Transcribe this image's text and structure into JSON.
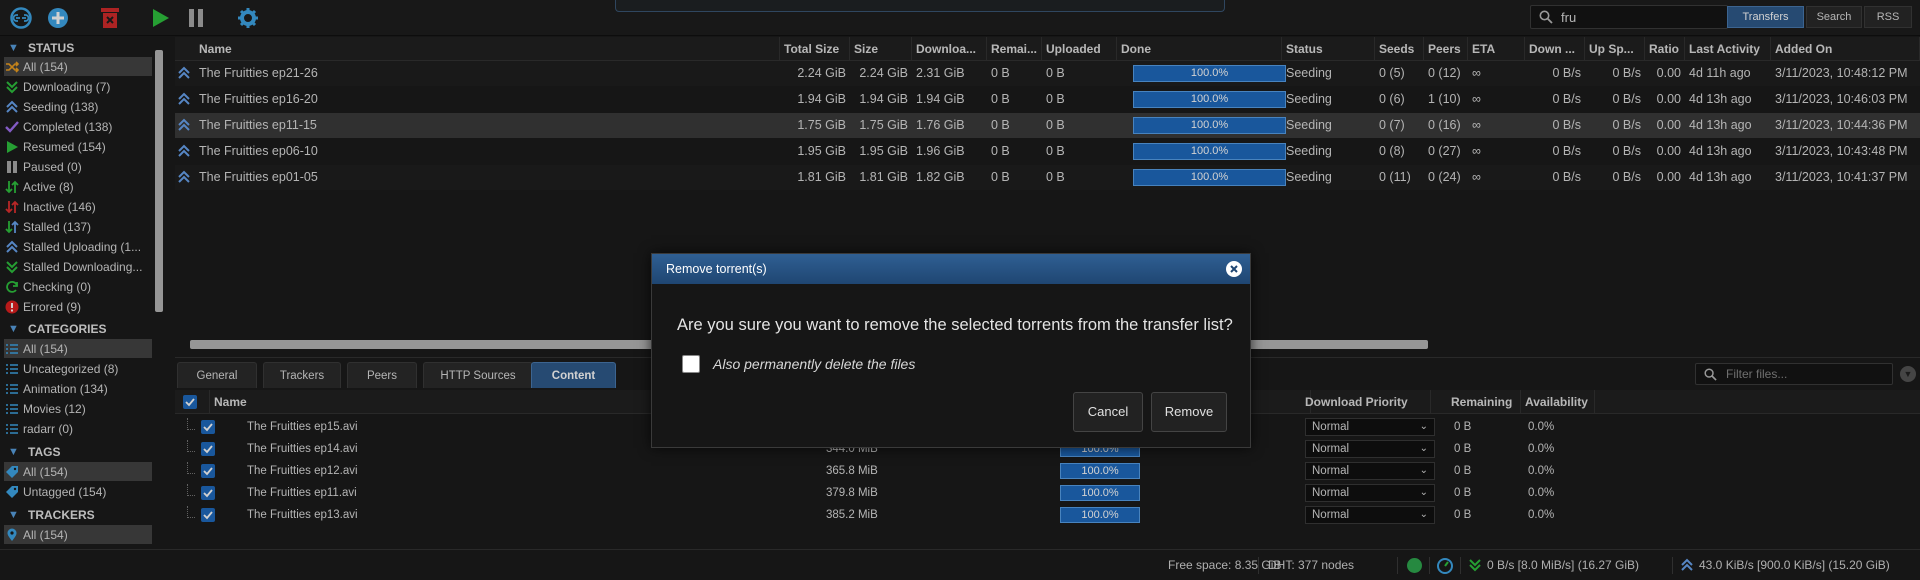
{
  "toolbar": {
    "icons": [
      "link-icon",
      "add-icon",
      "delete-icon",
      "play-icon",
      "pause-icon",
      "gear-icon"
    ],
    "search_value": "fru",
    "segments": [
      "Transfers",
      "Search",
      "RSS"
    ],
    "active_segment": "Transfers"
  },
  "sidebar": {
    "status_header": "STATUS",
    "status_items": [
      {
        "label": "All (154)",
        "icon": "shuffle-icon"
      },
      {
        "label": "Downloading (7)",
        "icon": "download-icon"
      },
      {
        "label": "Seeding (138)",
        "icon": "upload-icon"
      },
      {
        "label": "Completed (138)",
        "icon": "check-icon"
      },
      {
        "label": "Resumed (154)",
        "icon": "play-icon"
      },
      {
        "label": "Paused (0)",
        "icon": "pause-icon"
      },
      {
        "label": "Active (8)",
        "icon": "active-icon"
      },
      {
        "label": "Inactive (146)",
        "icon": "inactive-icon"
      },
      {
        "label": "Stalled (137)",
        "icon": "stalled-icon"
      },
      {
        "label": "Stalled Uploading (1...",
        "icon": "upload-icon"
      },
      {
        "label": "Stalled Downloading...",
        "icon": "download-icon"
      },
      {
        "label": "Checking (0)",
        "icon": "refresh-icon"
      },
      {
        "label": "Errored (9)",
        "icon": "error-icon"
      }
    ],
    "categories_header": "CATEGORIES",
    "category_items": [
      "All (154)",
      "Uncategorized (8)",
      "Animation (134)",
      "Movies (12)",
      "radarr (0)"
    ],
    "tags_header": "TAGS",
    "tag_items": [
      "All (154)",
      "Untagged (154)"
    ],
    "trackers_header": "TRACKERS",
    "tracker_items": [
      "All (154)"
    ]
  },
  "torrents": {
    "columns": [
      "Name",
      "Total Size",
      "Size",
      "Downloa...",
      "Remai...",
      "Uploaded",
      "Done",
      "Status",
      "Seeds",
      "Peers",
      "ETA",
      "Down ...",
      "Up Sp...",
      "Ratio",
      "Last Activity",
      "Added On"
    ],
    "rows": [
      {
        "name": "The Fruitties ep21-26",
        "total_size": "2.24 GiB",
        "size": "2.24 GiB",
        "downloaded": "2.31 GiB",
        "remaining": "0 B",
        "uploaded": "0 B",
        "done": "100.0%",
        "done_fraction": 1.0,
        "status": "Seeding",
        "seeds": "0 (5)",
        "peers": "0 (12)",
        "eta": "∞",
        "down": "0 B/s",
        "up": "0 B/s",
        "ratio": "0.00",
        "last_activity": "4d 11h ago",
        "added_on": "3/11/2023, 10:48:12 PM"
      },
      {
        "name": "The Fruitties ep16-20",
        "total_size": "1.94 GiB",
        "size": "1.94 GiB",
        "downloaded": "1.94 GiB",
        "remaining": "0 B",
        "uploaded": "0 B",
        "done": "100.0%",
        "done_fraction": 1.0,
        "status": "Seeding",
        "seeds": "0 (6)",
        "peers": "1 (10)",
        "eta": "∞",
        "down": "0 B/s",
        "up": "0 B/s",
        "ratio": "0.00",
        "last_activity": "4d 13h ago",
        "added_on": "3/11/2023, 10:46:03 PM"
      },
      {
        "name": "The Fruitties ep11-15",
        "total_size": "1.75 GiB",
        "size": "1.75 GiB",
        "downloaded": "1.76 GiB",
        "remaining": "0 B",
        "uploaded": "0 B",
        "done": "100.0%",
        "done_fraction": 1.0,
        "status": "Seeding",
        "seeds": "0 (7)",
        "peers": "0 (16)",
        "eta": "∞",
        "down": "0 B/s",
        "up": "0 B/s",
        "ratio": "0.00",
        "last_activity": "4d 13h ago",
        "added_on": "3/11/2023, 10:44:36 PM"
      },
      {
        "name": "The Fruitties ep06-10",
        "total_size": "1.95 GiB",
        "size": "1.95 GiB",
        "downloaded": "1.96 GiB",
        "remaining": "0 B",
        "uploaded": "0 B",
        "done": "100.0%",
        "done_fraction": 1.0,
        "status": "Seeding",
        "seeds": "0 (8)",
        "peers": "0 (27)",
        "eta": "∞",
        "down": "0 B/s",
        "up": "0 B/s",
        "ratio": "0.00",
        "last_activity": "4d 13h ago",
        "added_on": "3/11/2023, 10:43:48 PM"
      },
      {
        "name": "The Fruitties ep01-05",
        "total_size": "1.81 GiB",
        "size": "1.81 GiB",
        "downloaded": "1.82 GiB",
        "remaining": "0 B",
        "uploaded": "0 B",
        "done": "100.0%",
        "done_fraction": 1.0,
        "status": "Seeding",
        "seeds": "0 (11)",
        "peers": "0 (24)",
        "eta": "∞",
        "down": "0 B/s",
        "up": "0 B/s",
        "ratio": "0.00",
        "last_activity": "4d 13h ago",
        "added_on": "3/11/2023, 10:41:37 PM"
      }
    ]
  },
  "details": {
    "tabs": [
      "General",
      "Trackers",
      "Peers",
      "HTTP Sources",
      "Content"
    ],
    "active_tab": "Content",
    "filter_placeholder": "Filter files...",
    "columns": [
      "Name",
      "Download Priority",
      "Remaining",
      "Availability"
    ],
    "files": [
      {
        "name": "The Fruitties ep15.avi",
        "size": "",
        "progress": "",
        "priority": "Normal",
        "remaining": "0 B",
        "availability": "0.0%"
      },
      {
        "name": "The Fruitties ep14.avi",
        "size": "344.0 MiB",
        "progress": "100.0%",
        "priority": "Normal",
        "remaining": "0 B",
        "availability": "0.0%"
      },
      {
        "name": "The Fruitties ep12.avi",
        "size": "365.8 MiB",
        "progress": "100.0%",
        "priority": "Normal",
        "remaining": "0 B",
        "availability": "0.0%"
      },
      {
        "name": "The Fruitties ep11.avi",
        "size": "379.8 MiB",
        "progress": "100.0%",
        "priority": "Normal",
        "remaining": "0 B",
        "availability": "0.0%"
      },
      {
        "name": "The Fruitties ep13.avi",
        "size": "385.2 MiB",
        "progress": "100.0%",
        "priority": "Normal",
        "remaining": "0 B",
        "availability": "0.0%"
      }
    ]
  },
  "dialog": {
    "title": "Remove torrent(s)",
    "message": "Are you sure you want to remove the selected torrents from the transfer list?",
    "checkbox_label": "Also permanently delete the files",
    "cancel_label": "Cancel",
    "remove_label": "Remove"
  },
  "statusbar": {
    "free_space": "Free space: 8.35 GiB",
    "dht": "DHT: 377 nodes",
    "download": "0 B/s [8.0 MiB/s] (16.27 GiB)",
    "upload": "43.0 KiB/s [900.0 KiB/s] (15.20 GiB)"
  },
  "colors": {
    "accent": "#2f5b8c",
    "progress": "#1f6bbf",
    "background": "#1b1b1b"
  }
}
